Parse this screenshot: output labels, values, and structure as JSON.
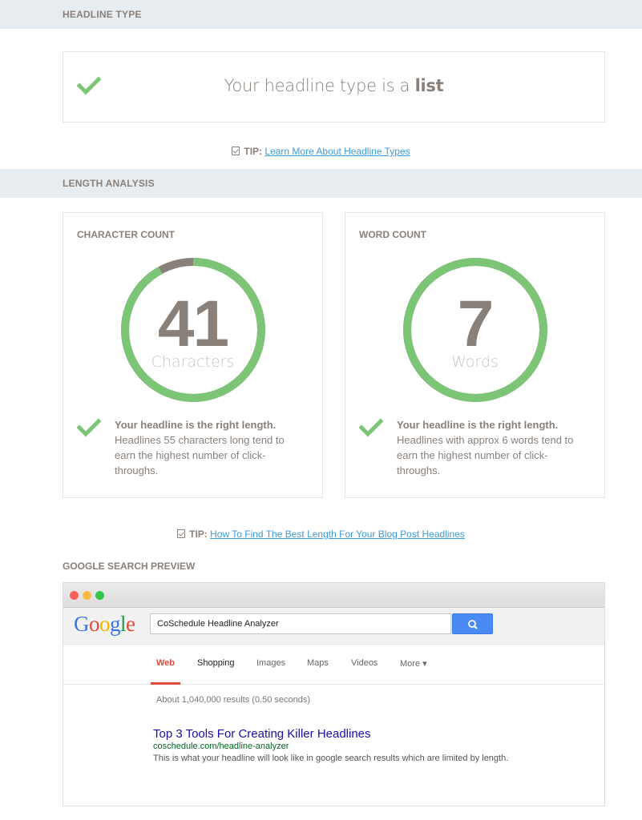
{
  "sections": {
    "headline_type": "HEADLINE TYPE",
    "length_analysis": "LENGTH ANALYSIS",
    "google_preview": "GOOGLE SEARCH PREVIEW"
  },
  "headline_type": {
    "prefix": "Your headline type is a",
    "type": "list"
  },
  "tips": [
    {
      "label": "TIP:",
      "link": "Learn More About Headline Types"
    },
    {
      "label": "TIP:",
      "link": "How To Find The Best Length For Your Blog Post Headlines"
    }
  ],
  "character_count": {
    "title": "CHARACTER COUNT",
    "value": "41",
    "unit": "Characters",
    "progress": 0.92,
    "msg_bold": "Your headline is the right length.",
    "msg_text": "Headlines 55 characters long tend to earn the highest number of click-throughs."
  },
  "word_count": {
    "title": "WORD COUNT",
    "value": "7",
    "unit": "Words",
    "progress": 1.0,
    "msg_bold": "Your headline is the right length.",
    "msg_text": "Headlines with approx 6 words tend to earn the highest number of click-throughs."
  },
  "google": {
    "logo": "Google",
    "query": "CoSchedule Headline Analyzer",
    "tabs": [
      "Web",
      "Shopping",
      "Images",
      "Maps",
      "Videos",
      "More ▾"
    ],
    "results_count": "About 1,040,000 results (0.50 seconds)",
    "result_title": "Top 3 Tools For Creating Killer Headlines",
    "result_url": "coschedule.com/headline-analyzer",
    "result_desc": "This is what your headline will look like in google search results which are limited by length."
  },
  "colors": {
    "green": "#7cc576",
    "ring_track": "#8a807a",
    "link": "#3d9ad6"
  }
}
